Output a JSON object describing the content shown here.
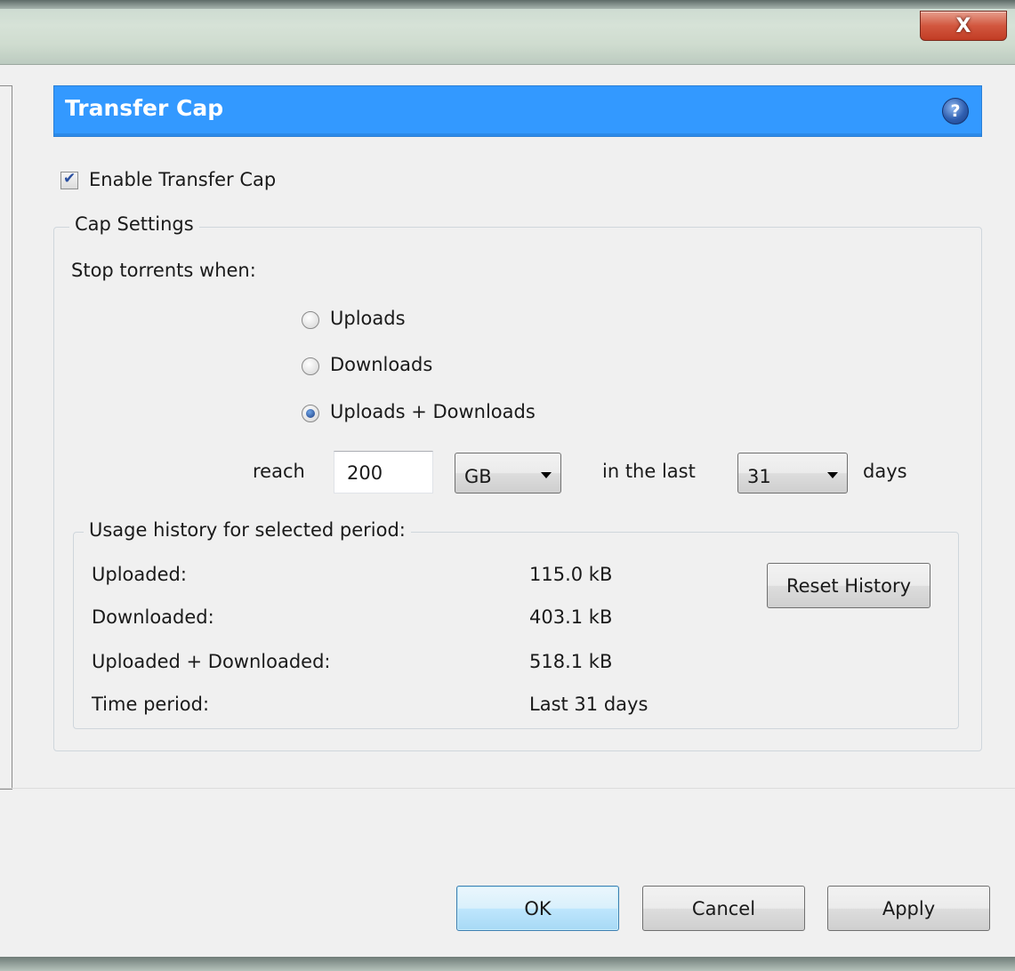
{
  "window": {
    "close_glyph": "X"
  },
  "header": {
    "title": "Transfer Cap",
    "help_glyph": "?"
  },
  "enable": {
    "label": "Enable Transfer Cap",
    "checked": true
  },
  "cap_settings": {
    "group_label": "Cap Settings",
    "stop_label": "Stop torrents when:",
    "options": [
      {
        "label": "Uploads",
        "checked": false
      },
      {
        "label": "Downloads",
        "checked": false
      },
      {
        "label": "Uploads + Downloads",
        "checked": true
      }
    ],
    "reach_label": "reach",
    "amount_value": "200",
    "unit_selected": "GB",
    "in_the_last_label": "in the last",
    "days_selected": "31",
    "days_label": "days"
  },
  "usage": {
    "group_label": "Usage history for selected period:",
    "rows": [
      {
        "label": "Uploaded:",
        "value": "115.0 kB"
      },
      {
        "label": "Downloaded:",
        "value": "403.1 kB"
      },
      {
        "label": "Uploaded + Downloaded:",
        "value": "518.1 kB"
      },
      {
        "label": "Time period:",
        "value": "Last 31 days"
      }
    ],
    "reset_label": "Reset History"
  },
  "footer": {
    "ok_label": "OK",
    "cancel_label": "Cancel",
    "apply_label": "Apply"
  },
  "colors": {
    "header_bg": "#3399ff",
    "close_button": "#c13c24",
    "default_button": "#a7d9f5"
  }
}
